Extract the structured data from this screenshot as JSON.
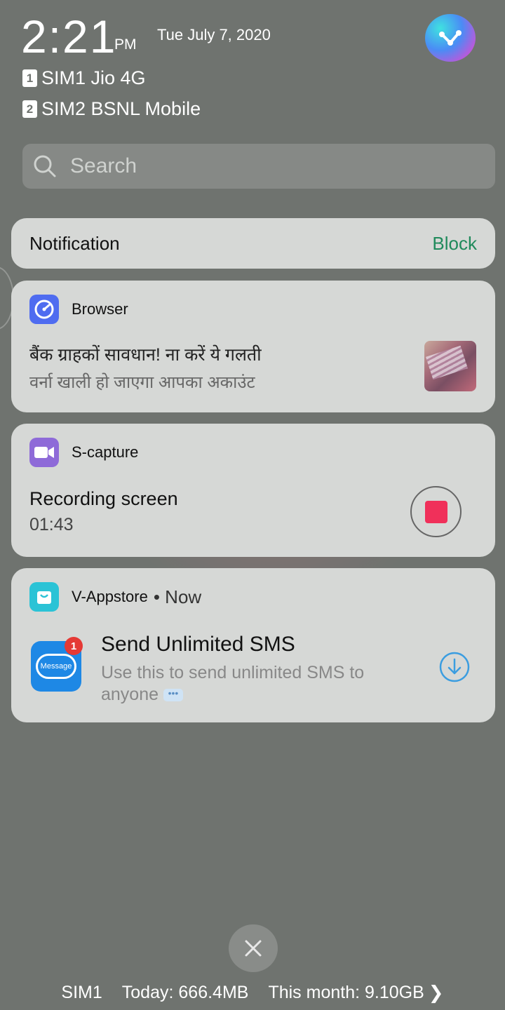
{
  "status": {
    "time": "2:21",
    "ampm": "PM",
    "date": "Tue July 7, 2020",
    "sims": [
      {
        "badge": "1",
        "label": "SIM1 Jio 4G"
      },
      {
        "badge": "2",
        "label": "SIM2 BSNL Mobile"
      }
    ]
  },
  "search": {
    "placeholder": "Search"
  },
  "notification_header": {
    "title": "Notification",
    "action": "Block"
  },
  "notifications": [
    {
      "app": "Browser",
      "icon": "compass-icon",
      "line1": "बैंक ग्राहकों सावधान! ना करें ये गलती",
      "line2": "वर्ना खाली हो जाएगा आपका अकाउंट"
    },
    {
      "app": "S-capture",
      "icon": "video-camera-icon",
      "title": "Recording screen",
      "elapsed": "01:43"
    },
    {
      "app": "V-Appstore",
      "time": "Now",
      "icon": "shopping-bag-icon",
      "badge": "1",
      "app_icon_label": "Message",
      "title": "Send Unlimited SMS",
      "desc": "Use this to send unlimited SMS to anyone"
    }
  ],
  "data_usage": {
    "sim": "SIM1",
    "today": "Today: 666.4MB",
    "month": "This month: 9.10GB"
  },
  "colors": {
    "background": "#6f736f",
    "card": "#d6d8d6",
    "block": "#1f8a5b",
    "record": "#f0305a",
    "browser_icon": "#4f6cf0",
    "scapture_icon": "#8e6ad8",
    "appstore_icon": "#2bc3d6",
    "message_icon": "#1e88e5"
  }
}
